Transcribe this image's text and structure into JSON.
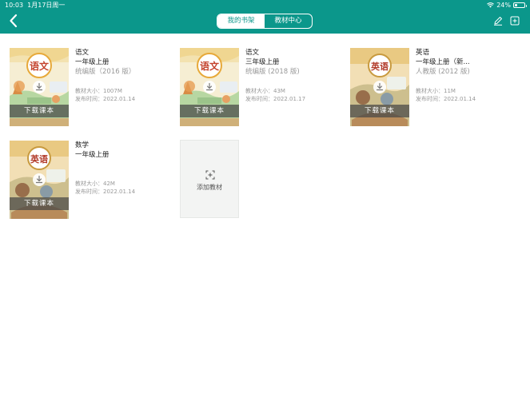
{
  "status_bar": {
    "time": "10:03",
    "date": "1月17日周一",
    "battery": "24%",
    "battery_level": 0.24
  },
  "header": {
    "tabs": [
      {
        "label": "我的书架",
        "active": true
      },
      {
        "label": "教材中心",
        "active": false
      }
    ],
    "icons": [
      "back-icon",
      "edit-icon",
      "add-square-icon"
    ]
  },
  "colors": {
    "header": "#0b978b",
    "download_bar": "#4d4d4d",
    "add_card": "#f3f4f3"
  },
  "download_label": "下载课本",
  "size_label": "教材大小：",
  "date_label": "发布时间：",
  "books": [
    {
      "subject": "语文",
      "grade": "一年级上册",
      "edition": "统编版（2016 版）",
      "size": "1007M",
      "date": "2022.01.14",
      "cover": "yuwen"
    },
    {
      "subject": "语文",
      "grade": "三年级上册",
      "edition": "统编版 (2018 版)",
      "size": "43M",
      "date": "2022.01.17",
      "cover": "yuwen"
    },
    {
      "subject": "英语",
      "grade": "一年级上册（新...",
      "edition": "人教版 (2012 版)",
      "size": "11M",
      "date": "2022.01.14",
      "cover": "yingyu"
    },
    {
      "subject": "数学",
      "grade": "一年级上册",
      "edition": "",
      "size": "42M",
      "date": "2022.01.14",
      "cover": "yingyu"
    }
  ],
  "add_book": {
    "label": "添加教材"
  },
  "cover_titles": {
    "yuwen": "语文",
    "yingyu": "英语"
  }
}
